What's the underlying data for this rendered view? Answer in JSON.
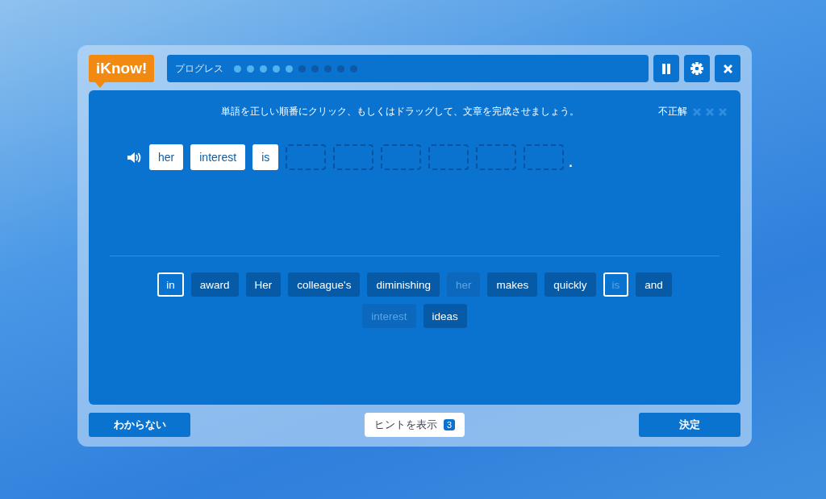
{
  "logo": {
    "text": "iKnow!"
  },
  "progress": {
    "label": "プログレス",
    "dots": [
      {
        "done": true
      },
      {
        "done": true
      },
      {
        "done": true
      },
      {
        "done": true
      },
      {
        "done": true
      },
      {
        "done": false
      },
      {
        "done": false
      },
      {
        "done": false
      },
      {
        "done": false
      },
      {
        "done": false
      }
    ]
  },
  "toolbar": [
    {
      "kind": "pause"
    },
    {
      "kind": "settings"
    },
    {
      "kind": "close"
    }
  ],
  "instruction": "単語を正しい順番にクリック、もしくはドラッグして、文章を完成させましょう。",
  "mistakes": {
    "label": "不正解",
    "marks": [
      {
        "active": false
      },
      {
        "active": false
      },
      {
        "active": false
      }
    ]
  },
  "answer": [
    {
      "kind": "word",
      "text": "her"
    },
    {
      "kind": "word",
      "text": "interest"
    },
    {
      "kind": "word",
      "text": "is"
    },
    {
      "kind": "blank"
    },
    {
      "kind": "blank"
    },
    {
      "kind": "blank"
    },
    {
      "kind": "blank"
    },
    {
      "kind": "blank"
    },
    {
      "kind": "blank"
    },
    {
      "kind": "period",
      "text": "."
    }
  ],
  "word_bank": [
    {
      "text": "in",
      "selected": true,
      "used": false
    },
    {
      "text": "award",
      "selected": false,
      "used": false
    },
    {
      "text": "Her",
      "selected": false,
      "used": false
    },
    {
      "text": "colleague's",
      "selected": false,
      "used": false
    },
    {
      "text": "diminishing",
      "selected": false,
      "used": false
    },
    {
      "text": "her",
      "selected": false,
      "used": true
    },
    {
      "text": "makes",
      "selected": false,
      "used": false
    },
    {
      "text": "quickly",
      "selected": false,
      "used": false
    },
    {
      "text": "is",
      "selected": true,
      "used": true
    },
    {
      "text": "and",
      "selected": false,
      "used": false
    },
    {
      "text": "interest",
      "selected": false,
      "used": true
    },
    {
      "text": "ideas",
      "selected": false,
      "used": false
    }
  ],
  "buttons": {
    "give_up": "わからない",
    "hint": {
      "label": "ヒントを表示",
      "count": "3"
    },
    "submit": "決定"
  }
}
